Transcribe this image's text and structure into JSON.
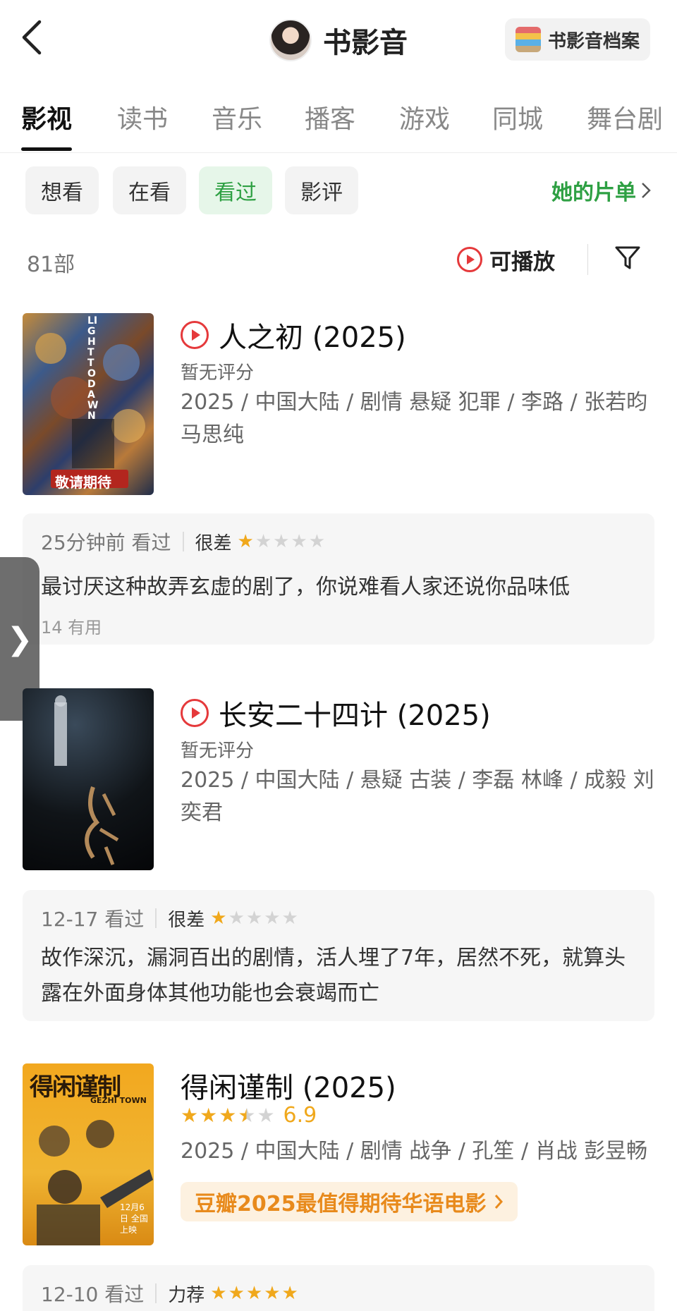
{
  "header": {
    "title": "书影音",
    "archive_label": "书影音档案"
  },
  "tabs": [
    {
      "label": "影视",
      "active": true
    },
    {
      "label": "读书"
    },
    {
      "label": "音乐"
    },
    {
      "label": "播客"
    },
    {
      "label": "游戏"
    },
    {
      "label": "同城"
    },
    {
      "label": "舞台剧"
    }
  ],
  "filters": {
    "chips": [
      "想看",
      "在看",
      "看过",
      "影评"
    ],
    "active": "看过",
    "her_list": "她的片单"
  },
  "list_info": {
    "count": "81部",
    "playable": "可播放"
  },
  "movies": [
    {
      "title": "人之初 (2025)",
      "playable": true,
      "rating_text": "暂无评分",
      "meta": "2025 / 中国大陆 / 剧情 悬疑 犯罪 / 李路 / 张若昀 马思纯",
      "poster_text": "敬请期待",
      "poster_en": "LIGHT TO DAWN",
      "review": {
        "time": "25分钟前 看过",
        "level": "很差",
        "stars": 1,
        "text": "最讨厌这种故弄玄虚的剧了，你说难看人家还说你品味低",
        "useful": "14 有用"
      }
    },
    {
      "title": "长安二十四计 (2025)",
      "playable": true,
      "rating_text": "暂无评分",
      "meta": "2025 / 中国大陆 / 悬疑 古装 / 李磊 林峰 / 成毅 刘奕君",
      "review": {
        "time": "12-17 看过",
        "level": "很差",
        "stars": 1,
        "text": "故作深沉，漏洞百出的剧情，活人埋了7年，居然不死，就算头露在外面身体其他功能也会衰竭而亡"
      }
    },
    {
      "title": "得闲谨制 (2025)",
      "playable": false,
      "score": "6.9",
      "score_stars": 3.5,
      "meta": "2025 / 中国大陆 / 剧情 战争 / 孔笙 / 肖战 彭昱畅",
      "tag": "豆瓣2025最值得期待华语电影",
      "poster_title": "得闲谨制",
      "poster_en": "GEZHI TOWN",
      "poster_date": "12月6日 全国上映",
      "review": {
        "time": "12-10 看过",
        "level": "力荐",
        "stars": 5
      }
    }
  ],
  "colors": {
    "accent_green": "#2ea043",
    "play_red": "#e5393b",
    "star_orange": "#f0a81c"
  }
}
